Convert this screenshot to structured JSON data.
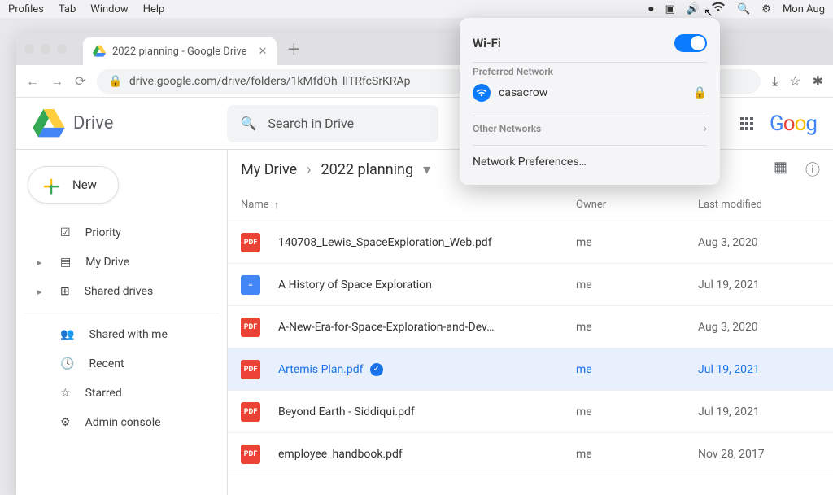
{
  "menubar": {
    "items": [
      "Profiles",
      "Tab",
      "Window",
      "Help"
    ],
    "clock": "Mon Aug"
  },
  "wifi": {
    "title": "Wi-Fi",
    "preferred_label": "Preferred Network",
    "network_name": "casacrow",
    "other_label": "Other Networks",
    "prefs": "Network Preferences…"
  },
  "browser": {
    "tab_title": "2022 planning - Google Drive",
    "url": "drive.google.com/drive/folders/1kMfdOh_lITRfcSrKRAp"
  },
  "drive": {
    "brand": "Drive",
    "search_placeholder": "Search in Drive",
    "account_brand": "Goog"
  },
  "sidebar": {
    "new": "New",
    "items": [
      {
        "label": "Priority"
      },
      {
        "label": "My Drive"
      },
      {
        "label": "Shared drives"
      },
      {
        "label": "Shared with me"
      },
      {
        "label": "Recent"
      },
      {
        "label": "Starred"
      },
      {
        "label": "Admin console"
      }
    ]
  },
  "breadcrumb": {
    "root": "My Drive",
    "current": "2022 planning"
  },
  "columns": {
    "name": "Name",
    "owner": "Owner",
    "modified": "Last modified"
  },
  "files": [
    {
      "type": "pdf",
      "name": "140708_Lewis_SpaceExploration_Web.pdf",
      "owner": "me",
      "modified": "Aug 3, 2020"
    },
    {
      "type": "doc",
      "name": "A History of Space Exploration",
      "owner": "me",
      "modified": "Jul 19, 2021"
    },
    {
      "type": "pdf",
      "name": "A-New-Era-for-Space-Exploration-and-Dev…",
      "owner": "me",
      "modified": "Aug 3, 2020"
    },
    {
      "type": "pdf",
      "name": "Artemis Plan.pdf",
      "owner": "me",
      "modified": "Jul 19, 2021"
    },
    {
      "type": "pdf",
      "name": "Beyond Earth - Siddiqui.pdf",
      "owner": "me",
      "modified": "Jul 19, 2021"
    },
    {
      "type": "pdf",
      "name": "employee_handbook.pdf",
      "owner": "me",
      "modified": "Nov 28, 2017"
    }
  ]
}
